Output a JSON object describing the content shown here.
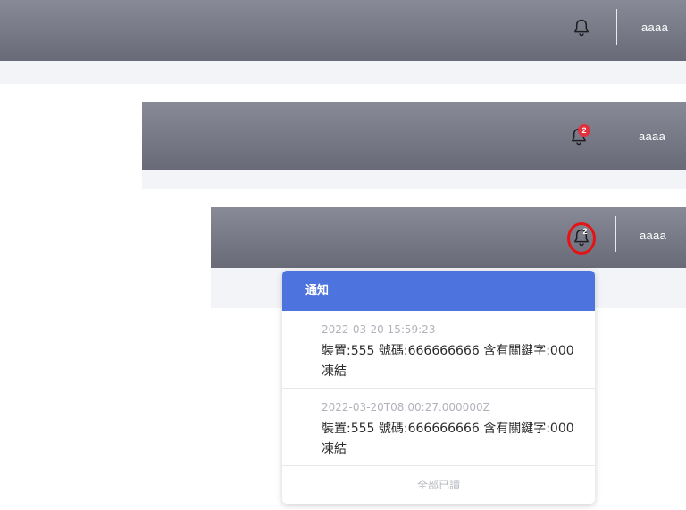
{
  "headers": [
    {
      "user": "aaaa",
      "badge": null
    },
    {
      "user": "aaaa",
      "badge": "2"
    },
    {
      "user": "aaaa",
      "badge": "2"
    }
  ],
  "notifications_panel": {
    "title": "通知",
    "items": [
      {
        "time": "2022-03-20 15:59:23",
        "text": "裝置:555 號碼:666666666 含有關鍵字:000 凍結"
      },
      {
        "time": "2022-03-20T08:00:27.000000Z",
        "text": "裝置:555 號碼:666666666 含有關鍵字:000 凍結"
      }
    ],
    "mark_all_read_label": "全部已讀"
  },
  "icons": {
    "bell": "bell-icon"
  },
  "colors": {
    "header_top": "#888a97",
    "header_bottom": "#696a77",
    "panel_header": "#4d73de",
    "badge": "#e0313f",
    "highlight_circle": "#e51414"
  }
}
